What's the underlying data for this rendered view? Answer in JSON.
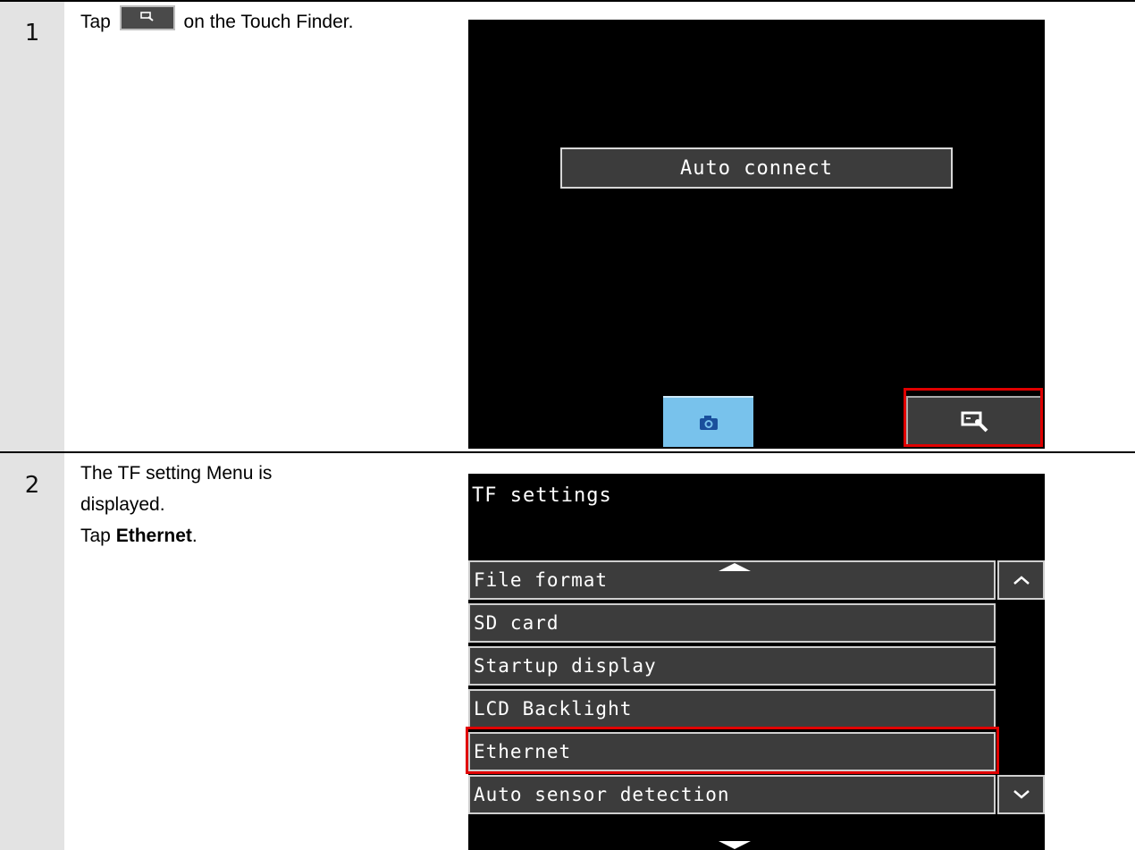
{
  "steps": [
    {
      "number": "1",
      "text_before": "Tap",
      "text_after": "on the Touch Finder.",
      "screen": {
        "center_button_label": "Auto connect",
        "left_icon": "camera-icon",
        "right_icon": "tool-settings-icon"
      }
    },
    {
      "number": "2",
      "lines": [
        "The TF setting Menu is",
        "displayed."
      ],
      "tap_prefix": "Tap ",
      "tap_target": "Ethernet",
      "tap_suffix": ".",
      "screen": {
        "title": "TF settings",
        "menu_items": [
          "File format",
          "SD card",
          "Startup display",
          "LCD Backlight",
          "Ethernet",
          "Auto sensor detection"
        ],
        "scroll_up_icon": "chevron-up-icon",
        "scroll_down_icon": "chevron-down-icon"
      }
    }
  ],
  "colors": {
    "highlight": "#e00000",
    "camera_button": "#78c2ec",
    "screen_bg": "#000000",
    "button_bg": "#3c3c3c"
  }
}
